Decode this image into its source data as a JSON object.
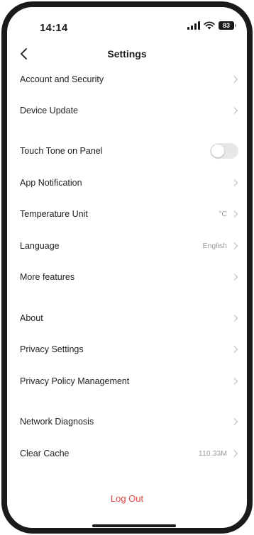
{
  "status_bar": {
    "time": "14:14",
    "battery": "83",
    "icons": [
      "signal-icon",
      "wifi-icon",
      "battery-icon"
    ]
  },
  "header": {
    "title": "Settings",
    "back_icon": "chevron-left-icon"
  },
  "settings": {
    "account_security": {
      "label": "Account and Security"
    },
    "device_update": {
      "label": "Device Update"
    },
    "touch_tone": {
      "label": "Touch Tone on Panel",
      "enabled": false
    },
    "app_notification": {
      "label": "App Notification"
    },
    "temperature_unit": {
      "label": "Temperature Unit",
      "value": "°C"
    },
    "language": {
      "label": "Language",
      "value": "English"
    },
    "more_features": {
      "label": "More features"
    },
    "about": {
      "label": "About"
    },
    "privacy_settings": {
      "label": "Privacy Settings"
    },
    "privacy_policy": {
      "label": "Privacy Policy Management"
    },
    "network_diagnosis": {
      "label": "Network Diagnosis"
    },
    "clear_cache": {
      "label": "Clear Cache",
      "value": "110.33M"
    }
  },
  "footer": {
    "logout_label": "Log Out",
    "logout_color": "#e64545"
  },
  "colors": {
    "text": "#1c1c1e",
    "secondary_text": "#9b9b9b",
    "toggle_off": "#e7e7ea"
  }
}
